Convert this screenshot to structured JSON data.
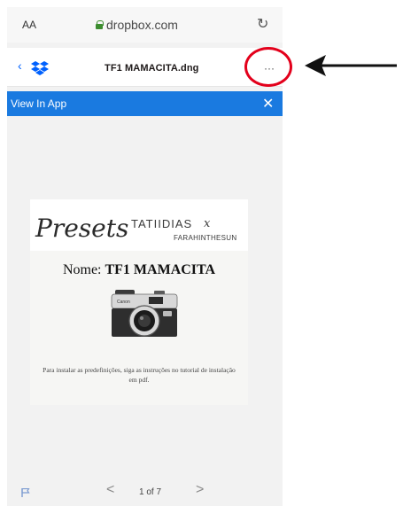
{
  "browser": {
    "text_size_label": "AA",
    "url": "dropbox.com",
    "reload_icon": "reload-icon"
  },
  "dropbox_header": {
    "back_icon": "chevron-left-icon",
    "logo_icon": "dropbox-logo-icon",
    "file_title": "TF1 MAMACITA.dng",
    "more_label": "···"
  },
  "banner": {
    "label": "View In App",
    "close_label": "✕"
  },
  "document": {
    "script_word": "Presets",
    "name_primary": "TATIIDIAS",
    "name_x": "x",
    "name_secondary": "FARAHINTHESUN",
    "nome_prefix": "Nome:",
    "nome_value": "TF1 MAMACITA",
    "camera_icon": "camera-icon",
    "camera_brand": "Canon",
    "caption": "Para instalar as predefinições, siga as instruções no tutorial de instalação em pdf."
  },
  "toolbar": {
    "flag_icon": "flag-icon",
    "prev_label": "<",
    "page_indicator": "1 of 7",
    "next_label": ">"
  },
  "annotation": {
    "highlight": "red-circle",
    "pointer": "black-arrow",
    "color": "#e3001b"
  }
}
